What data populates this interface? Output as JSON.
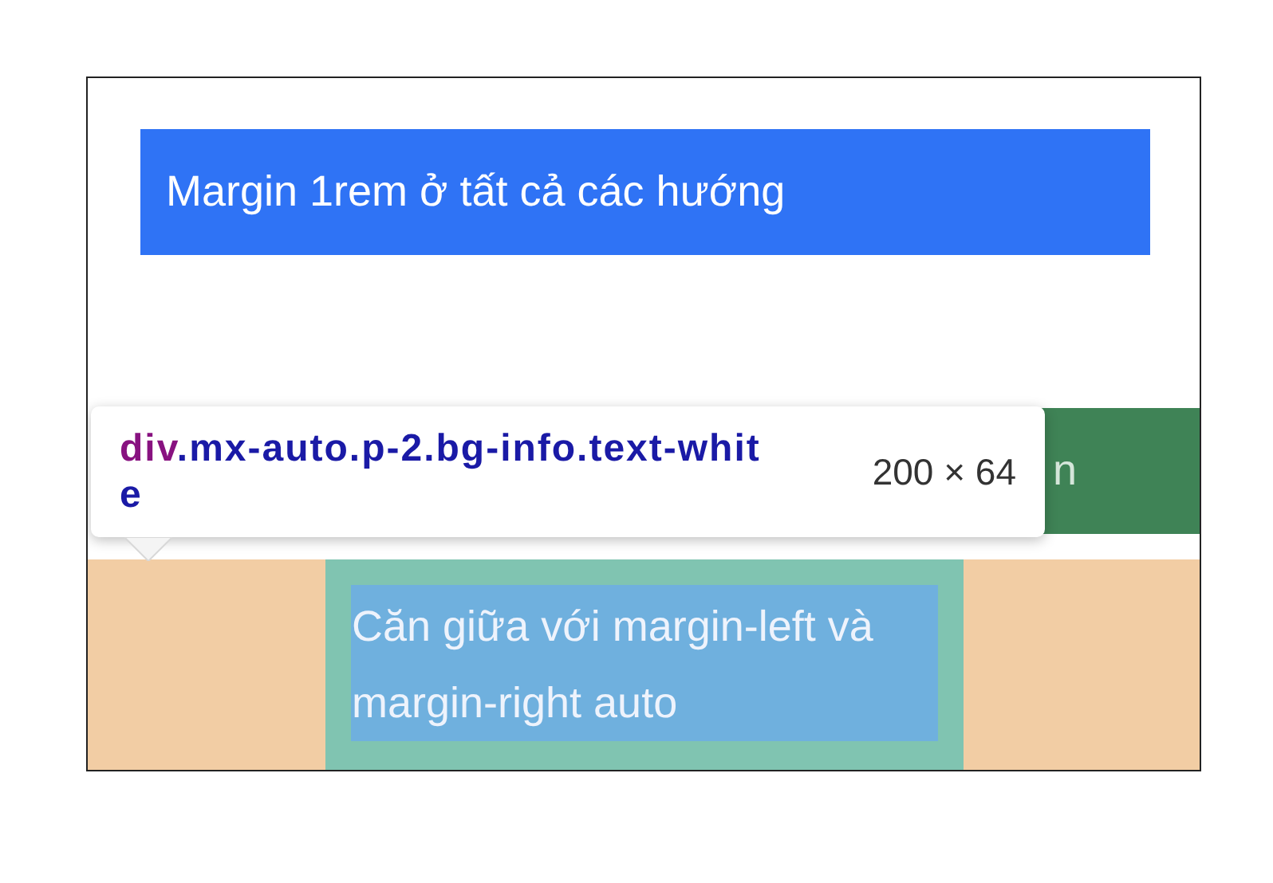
{
  "blue_box": {
    "text": "Margin 1rem ở tất cả các hướng"
  },
  "green_bar": {
    "text": "n"
  },
  "highlighted_box": {
    "text": "Căn giữa với margin-left và margin-right auto"
  },
  "inspector_tooltip": {
    "tag": "div",
    "classes": ".mx-auto.p-2.bg-info.text-white",
    "size": "200 × 64"
  }
}
